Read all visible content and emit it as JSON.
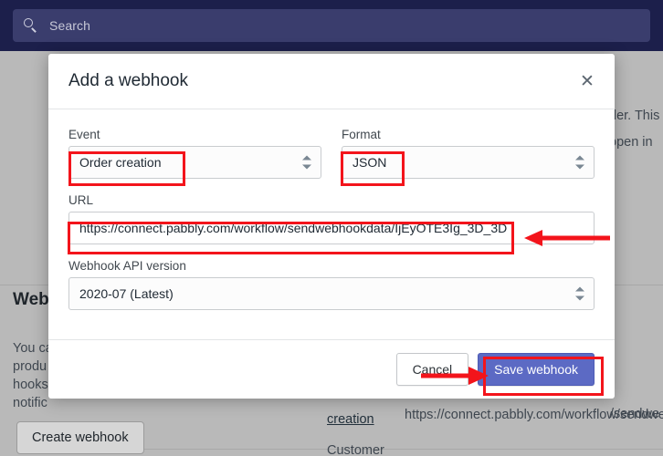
{
  "topbar": {
    "search_placeholder": "Search",
    "search_icon": "search-icon"
  },
  "background": {
    "heading": "Webhooks",
    "paragraph_lines": [
      "You ca",
      "produ",
      "hooks",
      "notific"
    ],
    "create_button": "Create webhook",
    "right_text_lines": [
      "der. This",
      "open in"
    ],
    "list": [
      {
        "event": "creation",
        "url": "https://connect.pabbly.com/workflow/sendwe"
      },
      {
        "event": "Customer",
        "url": ""
      }
    ],
    "top_url_fragment": "/sendwe"
  },
  "modal": {
    "title": "Add a webhook",
    "close_icon": "close-icon",
    "fields": {
      "event": {
        "label": "Event",
        "value": "Order creation"
      },
      "format": {
        "label": "Format",
        "value": "JSON"
      },
      "url": {
        "label": "URL",
        "value": "https://connect.pabbly.com/workflow/sendwebhookdata/IjEyOTE3Ig_3D_3D"
      },
      "api_version": {
        "label": "Webhook API version",
        "value": "2020-07 (Latest)"
      }
    },
    "footer": {
      "cancel": "Cancel",
      "save": "Save webhook"
    }
  },
  "colors": {
    "topbar": "#1c1f4b",
    "search_field": "#3a3d6d",
    "primary_button": "#5c6ac4",
    "annotation": "#f3141b",
    "overlay": "#b9b9b9"
  }
}
